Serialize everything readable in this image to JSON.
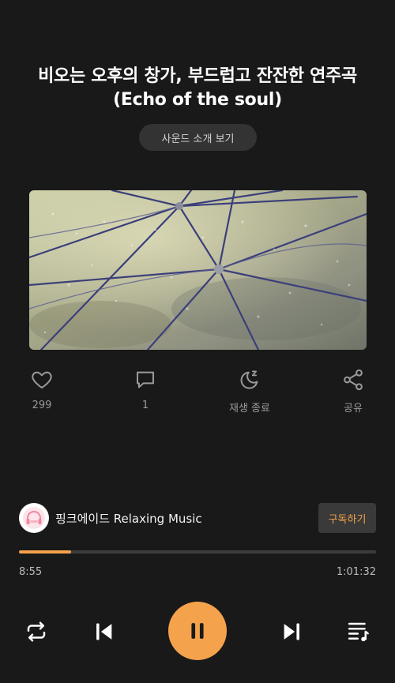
{
  "track": {
    "title": "비오는 오후의 창가, 부드럽고 잔잔한 연주곡 (Echo of the soul)",
    "intro_button": "사운드 소개 보기"
  },
  "actions": {
    "like": {
      "icon": "heart-icon",
      "count": "299"
    },
    "comment": {
      "icon": "comment-icon",
      "count": "1"
    },
    "sleep": {
      "icon": "sleep-timer-icon",
      "label": "재생 종료"
    },
    "share": {
      "icon": "share-icon",
      "label": "공유"
    }
  },
  "channel": {
    "name": "핑크에이드 Relaxing Music",
    "subscribe_label": "구독하기"
  },
  "player": {
    "current_time": "8:55",
    "total_time": "1:01:32",
    "progress": 0.145,
    "accent_color": "#f4a24c"
  },
  "controls": {
    "repeat": "repeat-icon",
    "previous": "previous-icon",
    "pause": "pause-icon",
    "next": "next-icon",
    "playlist": "playlist-icon"
  }
}
